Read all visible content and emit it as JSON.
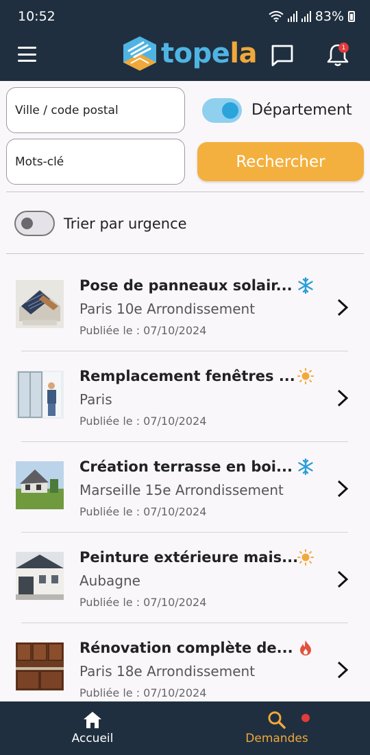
{
  "status": {
    "time": "10:52",
    "battery": "83%"
  },
  "header": {
    "logo_top": "tope",
    "logo_la": "la",
    "notification_count": "1"
  },
  "search": {
    "city_placeholder": "Ville / code postal",
    "keywords_placeholder": "Mots-clé",
    "departement_label": "Département",
    "departement_on": true,
    "search_button": "Rechercher"
  },
  "sort": {
    "urgency_label": "Trier par urgence",
    "urgency_on": false
  },
  "requests": [
    {
      "title": "Pose de panneaux solair...",
      "location": "Paris 10e Arrondissement",
      "date": "Publiée le : 07/10/2024",
      "urgency_icon": "snowflake-icon",
      "urgency_color": "#2a9fd6",
      "thumb": "solar-panel-roof-photo"
    },
    {
      "title": "Remplacement fenêtres ...",
      "location": "Paris",
      "date": "Publiée le : 07/10/2024",
      "urgency_icon": "sun-icon",
      "urgency_color": "#f2a93b",
      "thumb": "window-installation-photo"
    },
    {
      "title": "Création terrasse en boi...",
      "location": "Marseille 15e Arrondissement",
      "date": "Publiée le : 07/10/2024",
      "urgency_icon": "snowflake-icon",
      "urgency_color": "#2a9fd6",
      "thumb": "house-lawn-photo"
    },
    {
      "title": "Peinture extérieure mais...",
      "location": "Aubagne",
      "date": "Publiée le : 07/10/2024",
      "urgency_icon": "sun-icon",
      "urgency_color": "#f2a93b",
      "thumb": "house-facade-photo"
    },
    {
      "title": "Rénovation complète de...",
      "location": "Paris 18e Arrondissement",
      "date": "Publiée le : 07/10/2024",
      "urgency_icon": "flame-icon",
      "urgency_color": "#e0533d",
      "thumb": "wooden-kitchen-photo"
    }
  ],
  "nav": {
    "home": "Accueil",
    "requests": "Demandes"
  },
  "colors": {
    "header_bg": "#1f2f3f",
    "accent_orange": "#f4b03e",
    "accent_blue": "#2ba4db"
  }
}
